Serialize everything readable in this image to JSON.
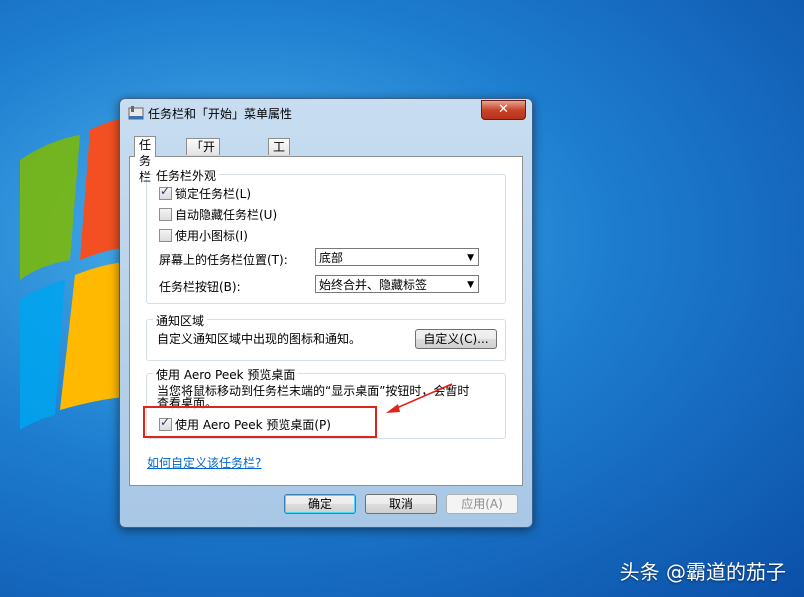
{
  "window": {
    "title": "任务栏和「开始」菜单属性",
    "close_glyph": "✕"
  },
  "tabs": [
    {
      "label": "任务栏",
      "active": true
    },
    {
      "label": "「开始」菜单",
      "active": false
    },
    {
      "label": "工具栏",
      "active": false
    }
  ],
  "appearance": {
    "title": "任务栏外观",
    "lock_label": "锁定任务栏(L)",
    "lock_checked": true,
    "autohide_label": "自动隐藏任务栏(U)",
    "autohide_checked": false,
    "small_icons_label": "使用小图标(I)",
    "small_icons_checked": false,
    "position_label": "屏幕上的任务栏位置(T):",
    "position_value": "底部",
    "buttons_label": "任务栏按钮(B):",
    "buttons_value": "始终合并、隐藏标签"
  },
  "notify": {
    "title": "通知区域",
    "description": "自定义通知区域中出现的图标和通知。",
    "customize_button": "自定义(C)..."
  },
  "aero": {
    "title": "使用 Aero Peek 预览桌面",
    "description_line1": "当您将鼠标移动到任务栏末端的“显示桌面”按钮时，会暂时",
    "description_line2": "查看桌面。",
    "checkbox_label": "使用 Aero Peek 预览桌面(P)",
    "checkbox_checked": true
  },
  "help_link": "如何自定义该任务栏?",
  "footer": {
    "ok": "确定",
    "cancel": "取消",
    "apply": "应用(A)"
  },
  "watermark": "头条 @霸道的茄子",
  "colors": {
    "annotation_red": "#e2231a",
    "link_blue": "#0066cc"
  }
}
